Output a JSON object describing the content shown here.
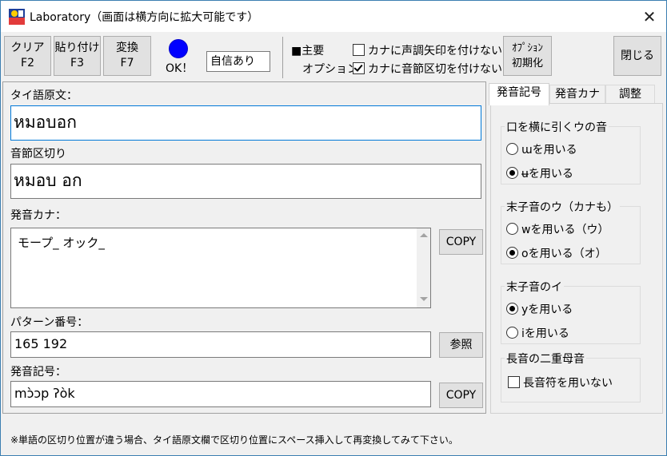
{
  "window": {
    "title": "Laboratory（画面は横方向に拡大可能です）",
    "close_glyph": "✕"
  },
  "toolbar": {
    "clear": {
      "label": "クリア",
      "key": "F2"
    },
    "paste": {
      "label": "貼り付け",
      "key": "F3"
    },
    "convert": {
      "label": "変換",
      "key": "F7"
    },
    "status_label": "OK！",
    "status_color": "#0000ff",
    "confidence_value": "自信あり",
    "main_label": "■主要",
    "option_label": "オプション",
    "no_tone_arrow_label": "カナに声調矢印を付けない",
    "no_tone_arrow_checked": false,
    "no_syllable_sep_label": "カナに音節区切を付けない",
    "no_syllable_sep_checked": true,
    "option_reset": {
      "line1": "ｵﾌﾟｼｮﾝ",
      "line2": "初期化"
    },
    "close_button": "閉じる"
  },
  "left": {
    "thai_label": "タイ語原文：",
    "thai_value": "หมอบอก",
    "syllable_label": "音節区切り",
    "syllable_value": "หมอบ อก",
    "kana_label": "発音カナ：",
    "kana_value": "モープ_ オック_",
    "kana_copy": "COPY",
    "pattern_label": "パターン番号：",
    "pattern_value": "165 192",
    "pattern_ref": "参照",
    "symbol_label": "発音記号：",
    "symbol_value": "mɔ̀ɔp ʔòk",
    "symbol_copy": "COPY"
  },
  "tabs": [
    {
      "label": "発音記号",
      "active": true
    },
    {
      "label": "発音カナ",
      "active": false
    },
    {
      "label": "調整",
      "active": false
    }
  ],
  "groups": {
    "g1": {
      "title": "口を横に引くウの音",
      "opt1": "ɯを用いる",
      "opt2": "ʉを用いる",
      "selected": 2
    },
    "g2": {
      "title": "末子音のウ（カナも）",
      "opt1": "wを用いる（ウ）",
      "opt2": "oを用いる（オ）",
      "selected": 2
    },
    "g3": {
      "title": "末子音のイ",
      "opt1": "yを用いる",
      "opt2": "iを用いる",
      "selected": 1
    },
    "g4": {
      "title": "長音の二重母音",
      "check_label": "長音符を用いない",
      "checked": false
    }
  },
  "status_text": "※単語の区切り位置が違う場合、タイ語原文欄で区切り位置にスペース挿入して再変換してみて下さい。"
}
